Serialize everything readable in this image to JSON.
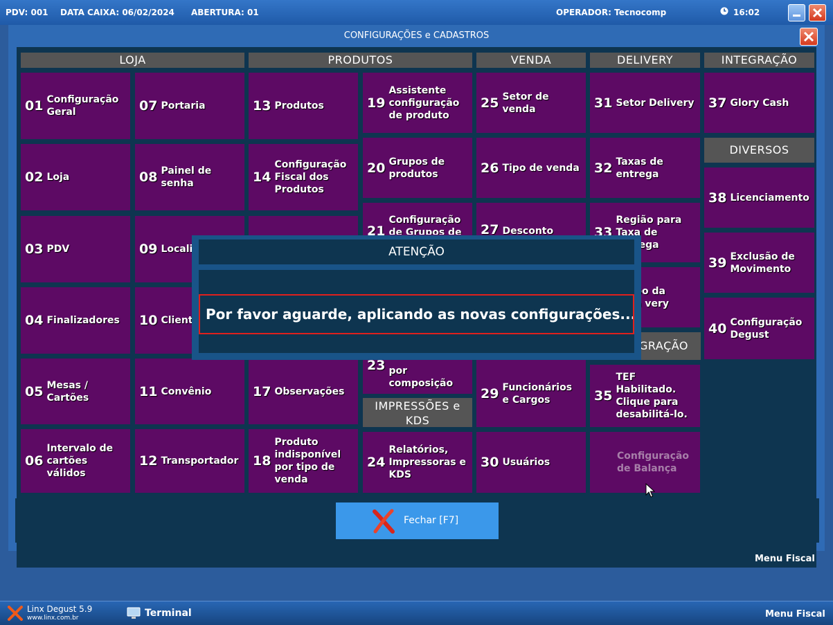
{
  "topbar": {
    "pdv": "PDV: 001",
    "data_caixa": "DATA CAIXA: 06/02/2024",
    "abertura": "ABERTURA: 01",
    "operador": "OPERADOR:  Tecnocomp",
    "clock_icon": "clock-icon",
    "time": "16:02",
    "minimize_icon": "minimize-icon",
    "close_icon": "close-icon"
  },
  "window": {
    "title": "CONFIGURAÇÕES e CADASTROS",
    "close_icon": "close-icon"
  },
  "sections": {
    "loja": "LOJA",
    "produtos": "PRODUTOS",
    "venda": "VENDA",
    "delivery": "DELIVERY",
    "integracao": "INTEGRAÇÃO",
    "diversos": "DIVERSOS",
    "impressoes": "IMPRESSÕES e KDS",
    "integracao2": "GRAÇÃO"
  },
  "tiles": {
    "t01": {
      "num": "01",
      "label": "Configuração Geral"
    },
    "t02": {
      "num": "02",
      "label": "Loja"
    },
    "t03": {
      "num": "03",
      "label": "PDV"
    },
    "t04": {
      "num": "04",
      "label": "Finalizadores"
    },
    "t05": {
      "num": "05",
      "label": "Mesas / Cartões"
    },
    "t06": {
      "num": "06",
      "label": "Intervalo de cartões válidos"
    },
    "t07": {
      "num": "07",
      "label": "Portaria"
    },
    "t08": {
      "num": "08",
      "label": "Painel de senha"
    },
    "t09": {
      "num": "09",
      "label": "Localiz"
    },
    "t10": {
      "num": "10",
      "label": "Cliente"
    },
    "t11": {
      "num": "11",
      "label": "Convênio"
    },
    "t12": {
      "num": "12",
      "label": "Transportador"
    },
    "t13": {
      "num": "13",
      "label": "Produtos"
    },
    "t14": {
      "num": "14",
      "label": "Configuração Fiscal dos Produtos"
    },
    "t15": {
      "num": "",
      "label": ""
    },
    "t17": {
      "num": "17",
      "label": "Observações"
    },
    "t18": {
      "num": "18",
      "label": "Produto indisponível por tipo de venda"
    },
    "t19": {
      "num": "19",
      "label": "Assistente configuração de produto"
    },
    "t20": {
      "num": "20",
      "label": "Grupos de produtos"
    },
    "t21": {
      "num": "21",
      "label": "Configuração de Grupos de"
    },
    "t23": {
      "num": "23",
      "label": "por composição"
    },
    "t24": {
      "num": "24",
      "label": "Relatórios, Impressoras e KDS"
    },
    "t25": {
      "num": "25",
      "label": "Setor de venda"
    },
    "t26": {
      "num": "26",
      "label": "Tipo de venda"
    },
    "t27": {
      "num": "27",
      "label": "Desconto"
    },
    "t29": {
      "num": "29",
      "label": "Funcionários e Cargos"
    },
    "t30": {
      "num": "30",
      "label": "Usuários"
    },
    "t31": {
      "num": "31",
      "label": "Setor Delivery"
    },
    "t32": {
      "num": "32",
      "label": "Taxas de entrega"
    },
    "t33": {
      "num": "33",
      "label": "Região para Taxa de Entrega"
    },
    "t34": {
      "num": "",
      "label": "po da a very"
    },
    "t35": {
      "num": "35",
      "label": "TEF Habilitado. Clique para desabilitá-lo."
    },
    "t36": {
      "num": "",
      "label": "Configuração de Balança"
    },
    "t37": {
      "num": "37",
      "label": "Glory Cash"
    },
    "t38": {
      "num": "38",
      "label": "Licenciamento"
    },
    "t39": {
      "num": "39",
      "label": "Exclusão de Movimento"
    },
    "t40": {
      "num": "40",
      "label": "Configuração Degust"
    }
  },
  "close_button": {
    "icon": "x-icon",
    "label": "Fechar [F7]"
  },
  "modal": {
    "title": "ATENÇÃO",
    "message": "Por favor aguarde, aplicando as novas configurações..."
  },
  "menu_fiscal_window": "Menu Fiscal",
  "taskbar": {
    "app_icon": "linx-logo-icon",
    "app_name": "Linx Degust 5.9",
    "app_url": "www.linx.com.br",
    "terminal_icon": "monitor-icon",
    "terminal": "Terminal",
    "menu_fiscal": "Menu Fiscal"
  }
}
